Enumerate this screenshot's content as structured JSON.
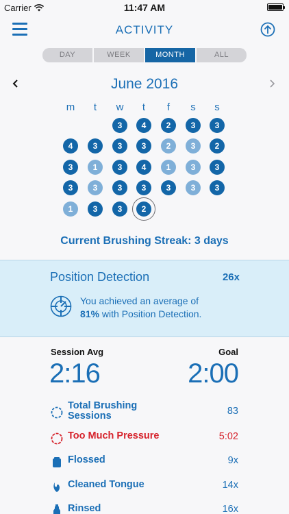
{
  "status_bar": {
    "carrier": "Carrier",
    "time": "11:47 AM"
  },
  "nav": {
    "title": "ACTIVITY",
    "menu_icon": "hamburger-icon",
    "upload_icon": "upload-arrow-icon"
  },
  "segments": [
    {
      "label": "DAY",
      "active": false
    },
    {
      "label": "WEEK",
      "active": false
    },
    {
      "label": "MONTH",
      "active": true
    },
    {
      "label": "ALL",
      "active": false
    }
  ],
  "calendar": {
    "month_label": "June 2016",
    "weekdays": [
      "m",
      "t",
      "w",
      "t",
      "f",
      "s",
      "s"
    ],
    "weeks": [
      [
        null,
        null,
        {
          "v": "3",
          "shade": "dark"
        },
        {
          "v": "4",
          "shade": "dark"
        },
        {
          "v": "2",
          "shade": "dark"
        },
        {
          "v": "3",
          "shade": "dark"
        },
        {
          "v": "3",
          "shade": "dark"
        }
      ],
      [
        {
          "v": "4",
          "shade": "dark"
        },
        {
          "v": "3",
          "shade": "dark"
        },
        {
          "v": "3",
          "shade": "dark"
        },
        {
          "v": "3",
          "shade": "dark"
        },
        {
          "v": "2",
          "shade": "light"
        },
        {
          "v": "3",
          "shade": "light"
        },
        {
          "v": "2",
          "shade": "dark"
        }
      ],
      [
        {
          "v": "3",
          "shade": "dark"
        },
        {
          "v": "1",
          "shade": "light"
        },
        {
          "v": "3",
          "shade": "dark"
        },
        {
          "v": "4",
          "shade": "dark"
        },
        {
          "v": "1",
          "shade": "light"
        },
        {
          "v": "3",
          "shade": "light"
        },
        {
          "v": "3",
          "shade": "dark"
        }
      ],
      [
        {
          "v": "3",
          "shade": "dark"
        },
        {
          "v": "3",
          "shade": "light"
        },
        {
          "v": "3",
          "shade": "dark"
        },
        {
          "v": "3",
          "shade": "dark"
        },
        {
          "v": "3",
          "shade": "dark"
        },
        {
          "v": "3",
          "shade": "light"
        },
        {
          "v": "3",
          "shade": "dark"
        }
      ],
      [
        {
          "v": "1",
          "shade": "light"
        },
        {
          "v": "3",
          "shade": "dark"
        },
        {
          "v": "3",
          "shade": "dark"
        },
        {
          "v": "2",
          "shade": "dark",
          "today": true
        },
        null,
        null,
        null
      ]
    ]
  },
  "streak_text": "Current Brushing Streak: 3 days",
  "position_detection": {
    "title": "Position Detection",
    "count": "26x",
    "message_before": "You achieved an average of",
    "percent": "81%",
    "message_after": "with Position Detection."
  },
  "session": {
    "avg_label": "Session Avg",
    "avg_value": "2:16",
    "goal_label": "Goal",
    "goal_value": "2:00"
  },
  "stats": [
    {
      "label": "Total Brushing Sessions",
      "value": "83",
      "icon": "dashed-circle-icon",
      "alert": false
    },
    {
      "label": "Too Much Pressure",
      "value": "5:02",
      "icon": "pressure-circle-icon",
      "alert": true
    },
    {
      "label": "Flossed",
      "value": "9x",
      "icon": "floss-icon",
      "alert": false
    },
    {
      "label": "Cleaned Tongue",
      "value": "14x",
      "icon": "tongue-icon",
      "alert": false
    },
    {
      "label": "Rinsed",
      "value": "16x",
      "icon": "rinse-bottle-icon",
      "alert": false
    }
  ],
  "colors": {
    "primary": "#1b6fb6",
    "dark_day": "#1366a8",
    "light_day": "#7fafd8",
    "panel": "#d9eef9",
    "alert": "#d6232c"
  }
}
